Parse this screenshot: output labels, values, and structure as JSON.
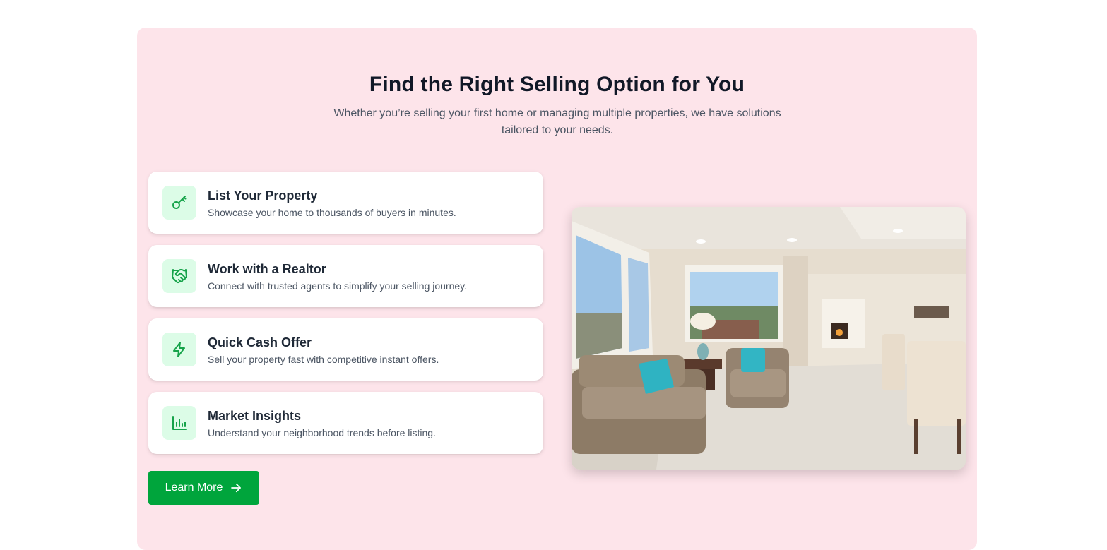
{
  "section": {
    "title": "Find the Right Selling Option for You",
    "subtitle": "Whether you’re selling your first home or managing multiple properties, we have solutions tailored to your needs."
  },
  "options": [
    {
      "icon": "key-icon",
      "title": "List Your Property",
      "description": "Showcase your home to thousands of buyers in minutes."
    },
    {
      "icon": "handshake-icon",
      "title": "Work with a Realtor",
      "description": "Connect with trusted agents to simplify your selling journey."
    },
    {
      "icon": "lightning-icon",
      "title": "Quick Cash Offer",
      "description": "Sell your property fast with competitive instant offers."
    },
    {
      "icon": "bar-chart-icon",
      "title": "Market Insights",
      "description": "Understand your neighborhood trends before listing."
    }
  ],
  "cta": {
    "label": "Learn More",
    "icon": "arrow-right-icon"
  },
  "image": {
    "subject": "living-room-photo"
  },
  "colors": {
    "panel_bg": "#fde4ea",
    "accent": "#00a53c",
    "icon_bg": "#dcfce7",
    "icon_stroke": "#16a34a"
  }
}
